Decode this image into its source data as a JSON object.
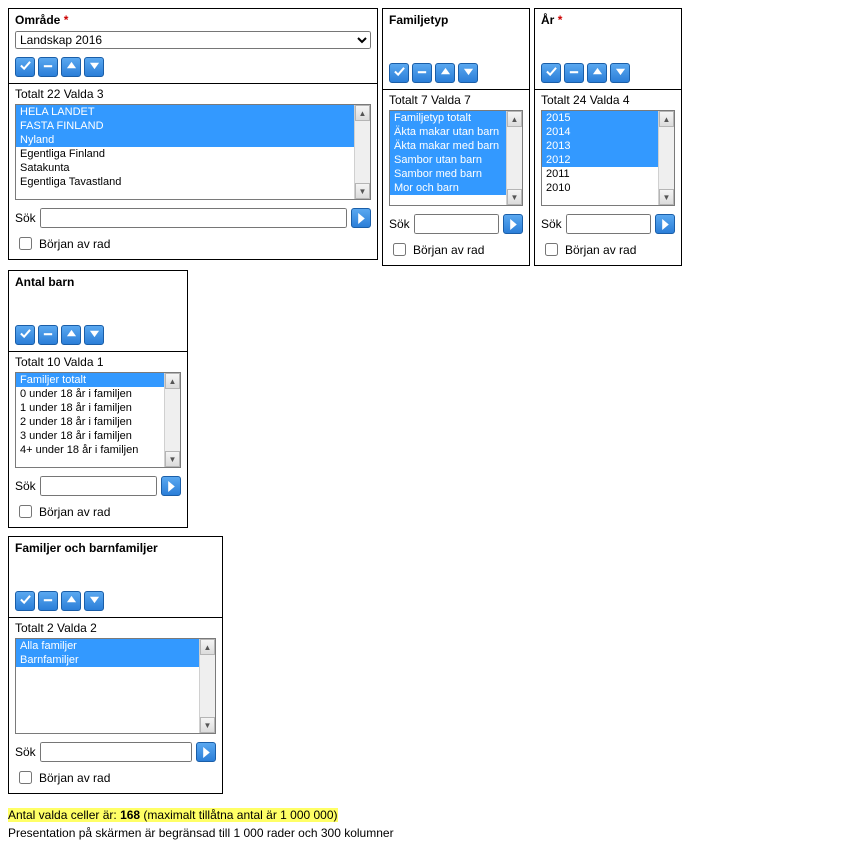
{
  "common": {
    "search_label": "Sök",
    "start_of_row": "Början av rad"
  },
  "panels": {
    "omrade": {
      "title": "Område",
      "required": true,
      "dropdown": "Landskap 2016",
      "totalt": 22,
      "valda": 3,
      "items": [
        {
          "label": "HELA LANDET",
          "sel": true
        },
        {
          "label": "FASTA FINLAND",
          "sel": true
        },
        {
          "label": "Nyland",
          "sel": true
        },
        {
          "label": "Egentliga Finland",
          "sel": false
        },
        {
          "label": "Satakunta",
          "sel": false
        },
        {
          "label": "Egentliga Tavastland",
          "sel": false
        }
      ]
    },
    "familjetyp": {
      "title": "Familjetyp",
      "required": false,
      "totalt": 7,
      "valda": 7,
      "items": [
        {
          "label": "Familjetyp totalt",
          "sel": true
        },
        {
          "label": "Äkta makar utan barn",
          "sel": true
        },
        {
          "label": "Äkta makar med barn",
          "sel": true
        },
        {
          "label": "Sambor utan barn",
          "sel": true
        },
        {
          "label": "Sambor med barn",
          "sel": true
        },
        {
          "label": "Mor och barn",
          "sel": true
        }
      ]
    },
    "ar": {
      "title": "År",
      "required": true,
      "totalt": 24,
      "valda": 4,
      "items": [
        {
          "label": "2015",
          "sel": true
        },
        {
          "label": "2014",
          "sel": true
        },
        {
          "label": "2013",
          "sel": true
        },
        {
          "label": "2012",
          "sel": true
        },
        {
          "label": "2011",
          "sel": false
        },
        {
          "label": "2010",
          "sel": false
        }
      ]
    },
    "antalbarn": {
      "title": "Antal barn",
      "required": false,
      "totalt": 10,
      "valda": 1,
      "items": [
        {
          "label": "Familjer totalt",
          "sel": true
        },
        {
          "label": "0 under 18 år i familjen",
          "sel": false
        },
        {
          "label": "1 under 18 år i familjen",
          "sel": false
        },
        {
          "label": "2 under 18 år i familjen",
          "sel": false
        },
        {
          "label": "3 under 18 år i familjen",
          "sel": false
        },
        {
          "label": "4+ under 18 år i familjen",
          "sel": false
        }
      ]
    },
    "familjer": {
      "title": "Familjer och barnfamiljer",
      "required": false,
      "totalt": 2,
      "valda": 2,
      "items": [
        {
          "label": "Alla familjer",
          "sel": true
        },
        {
          "label": "Barnfamiljer",
          "sel": true
        }
      ]
    }
  },
  "footer": {
    "count_prefix": "Antal valda celler är: ",
    "count_value": "168",
    "count_suffix": " (maximalt tillåtna antal är 1 000 000)",
    "line2": "Presentation på skärmen är begränsad till 1 000 rader och 300 kolumner"
  },
  "labels": {
    "totalt": "Totalt",
    "valda": "Valda"
  }
}
